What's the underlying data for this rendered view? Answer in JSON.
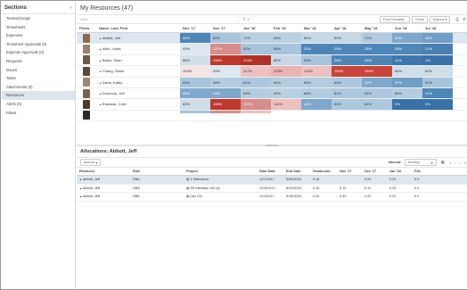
{
  "sidebar": {
    "title": "Sections",
    "collapse_icon": "double-chevron-left-icon",
    "items": [
      {
        "label": "Teams/Groups",
        "active": false
      },
      {
        "label": "Timesheets",
        "active": false
      },
      {
        "label": "Expenses",
        "active": false
      },
      {
        "label": "Timesheet Approvals (0)",
        "active": false
      },
      {
        "label": "Expense Approvals (0)",
        "active": false
      },
      {
        "label": "Requests",
        "active": false
      },
      {
        "label": "Issues",
        "active": false
      },
      {
        "label": "Tasks",
        "active": false
      },
      {
        "label": "Attachments (0)",
        "active": false
      },
      {
        "label": "Resources",
        "active": true
      },
      {
        "label": "Alerts (0)",
        "active": false
      },
      {
        "label": "Filters",
        "active": false
      }
    ]
  },
  "resources": {
    "title": "My Resources (47)",
    "filter_placeholder": "Filter",
    "columns": {
      "photo": "Photo",
      "name": "Name: Last, First"
    },
    "months": [
      "Nov '17",
      "Dec '17",
      "Jan '18",
      "Feb '18",
      "Mar '18",
      "Apr '18",
      "May '18",
      "Jun '18",
      "Jul '18"
    ],
    "toolbar": {
      "print": "Print Demand...",
      "email": "Email",
      "actions": "Actions"
    },
    "rows": [
      {
        "name": "Abbott, Jeff",
        "selected": true,
        "photo_color": "#8a6a55",
        "values": [
          "32%",
          "52%",
          "71%",
          "69%",
          "80%",
          "80%",
          "70%",
          "50%",
          "48%"
        ],
        "colors": [
          "#4f86b8",
          "#a6c4dc",
          "#b9d0e2",
          "#b9d0e2",
          "#c6d8e7",
          "#c6d8e7",
          "#b0cae0",
          "#7fa8cc",
          "#6f9ec6"
        ]
      },
      {
        "name": "Alvin, Linda",
        "selected": false,
        "photo_color": "#9a8070",
        "values": [
          "93%",
          "137%",
          "52%",
          "58%",
          "25%",
          "25%",
          "25%",
          "25%",
          "21%"
        ],
        "colors": [
          "#dde7ef",
          "#d98c8c",
          "#a6c4dc",
          "#a6c4dc",
          "#4f86b8",
          "#4f86b8",
          "#4f86b8",
          "#4f86b8",
          "#4a7fb2"
        ]
      },
      {
        "name": "Baker, Sean",
        "selected": false,
        "photo_color": "#6a5a4a",
        "values": [
          "86%",
          "198%",
          "213%",
          "80%",
          "53%",
          "26%",
          "26%",
          "11%",
          "1%"
        ],
        "colors": [
          "#d2dfea",
          "#c0392b",
          "#b22f24",
          "#c6d8e7",
          "#a6c4dc",
          "#4f86b8",
          "#4f86b8",
          "#3f77ad",
          "#3a72a8"
        ]
      },
      {
        "name": "Chang, Sarah",
        "selected": false,
        "photo_color": "#5a4a3a",
        "values": [
          "104%",
          "93%",
          "117%",
          "123%",
          "115%",
          "150%",
          "150%",
          "85%",
          "82%"
        ],
        "colors": [
          "#f4e4e4",
          "#dde7ef",
          "#eec0c0",
          "#eab4b4",
          "#eec0c0",
          "#c9453a",
          "#c9453a",
          "#d2dfea",
          "#cfdde9"
        ]
      },
      {
        "name": "Davis, Kathy",
        "selected": false,
        "photo_color": "#a08878",
        "values": [
          "54%",
          "65%",
          "61%",
          "64%",
          "65%",
          "60%",
          "47%",
          "37%",
          "51%"
        ],
        "colors": [
          "#a6c4dc",
          "#b3cce0",
          "#adc8de",
          "#b3cce0",
          "#b3cce0",
          "#adc8de",
          "#7fa8cc",
          "#6f9ec6",
          "#a6c4dc"
        ]
      },
      {
        "name": "Donohoe, Jeff",
        "selected": false,
        "photo_color": "#7a6050",
        "values": [
          "45%",
          "43%",
          "65%",
          "69%",
          "66%",
          "61%",
          "61%",
          "66%",
          "31%"
        ],
        "colors": [
          "#7fa8cc",
          "#7fa8cc",
          "#b3cce0",
          "#b9d0e2",
          "#b3cce0",
          "#adc8de",
          "#adc8de",
          "#b3cce0",
          "#4f86b8"
        ]
      },
      {
        "name": "Edwards, Colin",
        "selected": false,
        "photo_color": "#4a3a2a",
        "values": [
          "83%",
          "198%",
          "137%",
          "114%",
          "44%",
          "60%",
          "61%",
          "0%",
          "0%"
        ],
        "colors": [
          "#cfdde9",
          "#c0392b",
          "#d98c8c",
          "#eec0c0",
          "#7fa8cc",
          "#adc8de",
          "#adc8de",
          "#3a72a8",
          "#3a72a8"
        ]
      },
      {
        "name": "",
        "selected": false,
        "photo_color": "#2a2a2a",
        "values": [
          "",
          "",
          "",
          "",
          "",
          "",
          "",
          "",
          ""
        ],
        "colors": [
          "#a6c4dc",
          "#d98c8c",
          "#eec0c0",
          "#ffffff",
          "#ffffff",
          "#ffffff",
          "#ffffff",
          "#ffffff",
          "#ffffff"
        ]
      }
    ]
  },
  "allocations": {
    "title": "Allocations: Abbott, Jeff",
    "actions_label": "Actions",
    "interval_label": "Interval:",
    "interval_value": "Monthly",
    "columns": [
      "Resource",
      "Role",
      "Project",
      "Start Date",
      "End Date",
      "Headcount",
      "Nov '17",
      "Dec '17",
      "Jan '18",
      "Feb"
    ],
    "rows": [
      {
        "resource": "Abbott, Jeff",
        "role": "DBA",
        "project": "1 Salesforce",
        "start": "12/1/2017",
        "end": "5/26/2018",
        "headcount": "0.16",
        "nov": "",
        "dec": "0.24",
        "jan": "0.20",
        "feb": "0.0",
        "selected": true
      },
      {
        "resource": "Abbott, Jeff",
        "role": "DBA",
        "project": "AP Interface Set Up",
        "start": "11/20/2017",
        "end": "6/23/2018",
        "headcount": "0.10",
        "nov": "0.10",
        "dec": "0.10",
        "jan": "0.25",
        "feb": "0.0",
        "selected": false
      },
      {
        "resource": "Abbott, Jeff",
        "role": "DBA",
        "project": "Lab 101",
        "start": "11/1/2017",
        "end": "5/18/2018",
        "headcount": "0.20",
        "nov": "0.33",
        "dec": "0.20",
        "jan": "0.20",
        "feb": "0.0",
        "selected": false
      }
    ]
  }
}
